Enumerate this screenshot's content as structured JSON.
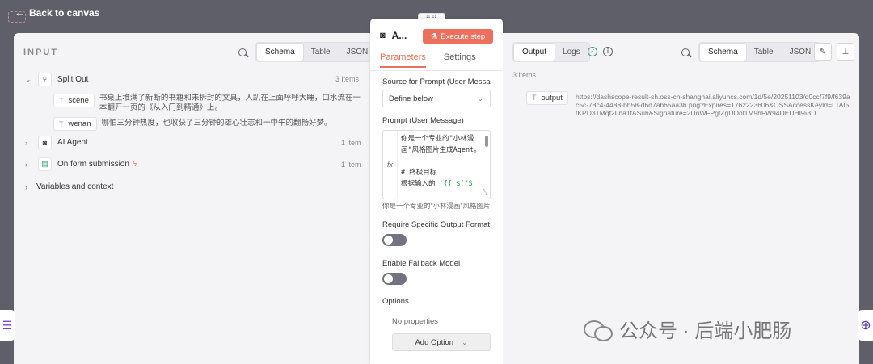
{
  "nav": {
    "back_label": "Back to canvas"
  },
  "input": {
    "title": "INPUT",
    "views": [
      "Schema",
      "Table",
      "JSON"
    ],
    "active_view": "Schema",
    "nodes": [
      {
        "label": "Split Out",
        "count": "3 items",
        "fields": [
          {
            "name": "scene",
            "value": "书桌上堆满了新断的书籍和未拆封的文具，人趴在上面呼呼大睡，口水流在一本翻开一页的《从入门到精通》上。"
          },
          {
            "name": "wenan",
            "value": "哪怕三分钟热度，也收获了三分钟的雄心壮志和一中午的翻畅好梦。"
          }
        ]
      },
      {
        "label": "AI Agent",
        "count": "1 item"
      },
      {
        "label": "On form submission",
        "count": "1 item"
      },
      {
        "label": "Variables and context"
      }
    ]
  },
  "node": {
    "title": "A...",
    "execute_label": "Execute step",
    "tabs": [
      "Parameters",
      "Settings"
    ],
    "source_label": "Source for Prompt (User Message)",
    "source_value": "Define below",
    "prompt_label": "Prompt (User Message)",
    "prompt_code_1": "你是一个专业的\"小林漫画\"风格图片生成Agent。",
    "prompt_code_2": "# 终极目标",
    "prompt_code_3a": "根据输入的 ",
    "prompt_code_3b": "`{{ $(\"S",
    "prompt_preview": "你是一个专业的\"小林漫画\"风格图片生成Agent。",
    "require_label": "Require Specific Output Format",
    "fallback_label": "Enable Fallback Model",
    "options_label": "Options",
    "no_props": "No properties",
    "add_option": "Add Option"
  },
  "output": {
    "tabs": [
      "Output",
      "Logs"
    ],
    "views": [
      "Schema",
      "Table",
      "JSON"
    ],
    "active_view": "Schema",
    "count": "3 items",
    "field_name": "output",
    "field_value": "https://dashscope-result-sh.oss-cn-shanghai.aliyuncs.com/1d/5e/20251103/d0ccf7f9/f639ac5c-78c4-4488-bb58-d6d7ab65aa3b.png?Expires=1762223606&OSSAccessKeyId=LTAI5tKPD3TMqf2Lna1fASuh&Signature=2UoWFPgtZgUOol1M9hFW94DEDHI%3D"
  },
  "watermark": "公众号 · 后端小肥肠"
}
